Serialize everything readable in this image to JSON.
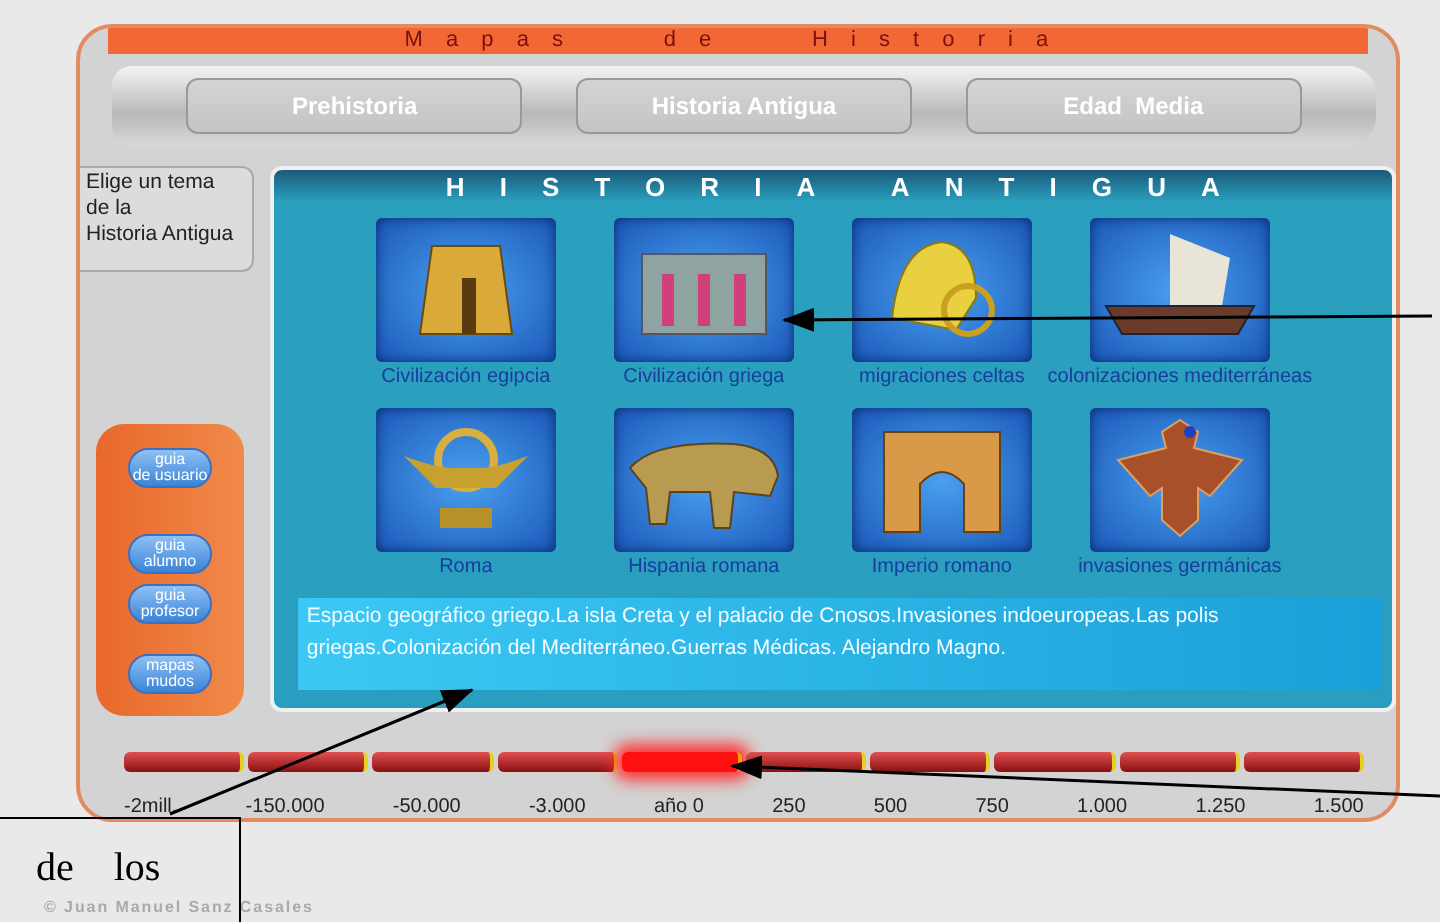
{
  "title_bar": {
    "title": "Mapas de Historia"
  },
  "nav_tabs": [
    {
      "label": "Prehistoria",
      "selected": false
    },
    {
      "label": "Historia Antigua",
      "selected": false
    },
    {
      "label": "Edad  Media",
      "selected": false
    }
  ],
  "prompt": "Elige  un tema\nde la\nHistoria Antigua",
  "side_buttons": [
    "guia\nde usuario",
    "guia\nalumno",
    "guia\nprofesor",
    "mapas\nmudos"
  ],
  "panel": {
    "title": "HISTORIA ANTIGUA",
    "topics": [
      {
        "label": "Civilización egipcia"
      },
      {
        "label": "Civilización griega"
      },
      {
        "label": "migraciones celtas"
      },
      {
        "label": "colonizaciones mediterráneas"
      },
      {
        "label": "Roma"
      },
      {
        "label": "Hispania romana"
      },
      {
        "label": "Imperio romano"
      },
      {
        "label": "invasiones germánicas"
      }
    ],
    "description": "Espacio geográfico griego.La isla Creta y el palacio de Cnosos.Invasiones indoeuropeas.Las polis griegas.Colonización del Mediterráneo.Guerras Médicas. Alejandro Magno."
  },
  "timeline": {
    "labels": [
      "-2mill.",
      "-150.000",
      "-50.000",
      "-3.000",
      "año 0",
      "250",
      "500",
      "750",
      "1.000",
      "1.250",
      "1.500"
    ],
    "periods": [
      {
        "selected": false
      },
      {
        "selected": false
      },
      {
        "selected": false
      },
      {
        "selected": false
      },
      {
        "selected": true
      },
      {
        "selected": false
      },
      {
        "selected": false
      },
      {
        "selected": false
      },
      {
        "selected": false
      },
      {
        "selected": false
      }
    ]
  },
  "copyright": "© Juan Manuel Sanz Casales",
  "annotation": {
    "text": "de    los"
  }
}
